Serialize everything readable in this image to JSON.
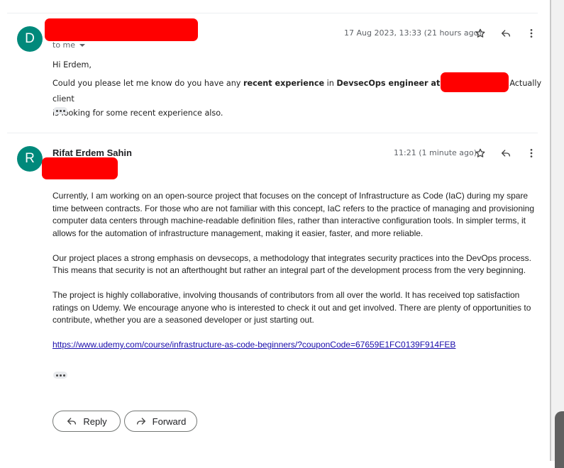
{
  "message1": {
    "avatar_letter": "D",
    "recipient": "to me",
    "date": "17 Aug 2023, 13:33 (21 hours ago)",
    "greeting": "Hi Erdem,",
    "text_before": "Could you please let me know do you have any ",
    "bold_1": "recent experience",
    "text_mid": " in ",
    "bold_2": "DevsecOps engineer at",
    "text_after": "Actually client",
    "text_line3": "is looking for some recent experience also."
  },
  "message2": {
    "avatar_letter": "R",
    "sender": "Rifat Erdem Sahin",
    "date": "11:21 (1 minute ago)",
    "paragraphs": [
      "Currently, I am working on an open-source project that focuses on the concept of Infrastructure as Code (IaC) during my spare time between contracts. For those who are not familiar with this concept, IaC refers to the practice of managing and provisioning computer data centers through machine-readable definition files, rather than interactive configuration tools. In simpler terms, it allows for the automation of infrastructure management, making it easier, faster, and more reliable.",
      "Our project places a strong emphasis on devsecops, a methodology that integrates security practices into the DevOps process. This means that security is not an afterthought but rather an integral part of the development process from the very beginning.",
      "The project is highly collaborative, involving thousands of contributors from all over the world. It has received top satisfaction ratings on Udemy. We encourage anyone who is interested to check it out and get involved. There are plenty of opportunities to contribute, whether you are a seasoned developer or just starting out."
    ],
    "link": "https://www.udemy.com/course/infrastructure-as-code-beginners/?couponCode=67659E1FC0139F914FEB"
  },
  "actions": {
    "reply_label": "Reply",
    "forward_label": "Forward"
  },
  "icons": [
    "star-icon",
    "reply-icon",
    "more-vert-icon",
    "forward-icon"
  ],
  "colors": {
    "avatar": "#00897b",
    "redaction": "#ff0000",
    "link": "#1a0dab"
  }
}
